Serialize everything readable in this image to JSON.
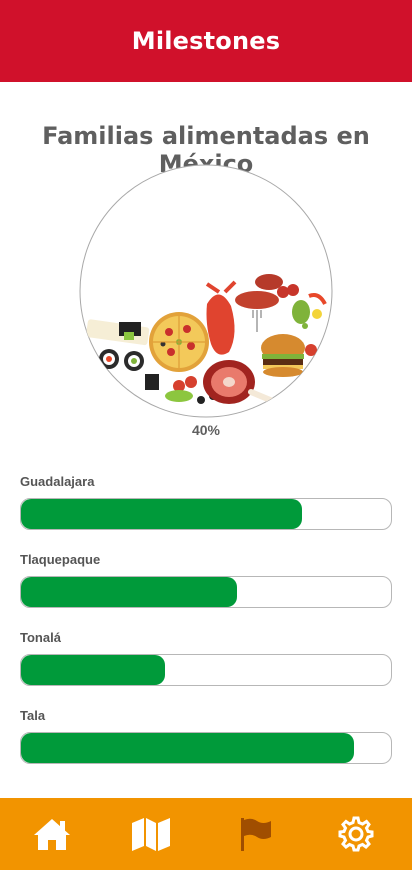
{
  "header": {
    "title": "Milestones"
  },
  "main": {
    "subtitle": "Familias alimentadas en México",
    "progress": {
      "fraction": 0.4,
      "label": "40%"
    },
    "cities": [
      {
        "name": "Guadalajara",
        "progress": 0.76
      },
      {
        "name": "Tlaquepaque",
        "progress": 0.585
      },
      {
        "name": "Tonalá",
        "progress": 0.39
      },
      {
        "name": "Tala",
        "progress": 0.9
      }
    ]
  },
  "nav": {
    "items": [
      {
        "icon": "home-icon",
        "active": false
      },
      {
        "icon": "map-icon",
        "active": false
      },
      {
        "icon": "flag-icon",
        "active": true
      },
      {
        "icon": "gear-icon",
        "active": false
      }
    ]
  },
  "colors": {
    "header": "#d0112b",
    "accent_bar": "#009a3a",
    "nav": "#f29400",
    "text": "#5f5f5f"
  }
}
